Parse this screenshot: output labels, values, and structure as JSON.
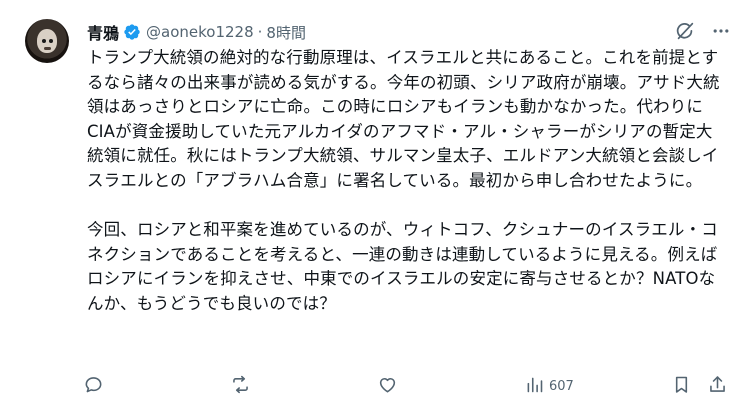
{
  "author": {
    "name": "青鴉",
    "handle": "@aoneko1228",
    "separator": "·",
    "time": "8時間"
  },
  "post": {
    "paragraph1": "トランプ大統領の絶対的な行動原理は、イスラエルと共にあること。これを前提とするなら諸々の出来事が読める気がする。今年の初頭、シリア政府が崩壊。アサド大統領はあっさりとロシアに亡命。この時にロシアもイランも動かなかった。代わりにCIAが資金援助していた元アルカイダのアフマド・アル・シャラーがシリアの暫定大統領に就任。秋にはトランプ大統領、サルマン皇太子、エルドアン大統領と会談しイスラエルとの「アブラハム合意」に署名している。最初から申し合わせたように。",
    "paragraph2": "今回、ロシアと和平案を進めているのが、ウィトコフ、クシュナーのイスラエル・コネクションであることを考えると、一連の動きは連動しているように見える。例えばロシアにイランを抑えさせ、中東でのイスラエルの安定に寄与させるとか？NATOなんか、もうどうでも良いのでは？"
  },
  "stats": {
    "views": "607"
  },
  "colors": {
    "verified": "#1d9bf0",
    "text": "#0f1419",
    "muted": "#536471"
  },
  "icons": [
    "verified-badge-icon",
    "grok-icon",
    "more-icon",
    "reply-icon",
    "repost-icon",
    "like-icon",
    "views-icon",
    "bookmark-icon",
    "share-icon"
  ]
}
